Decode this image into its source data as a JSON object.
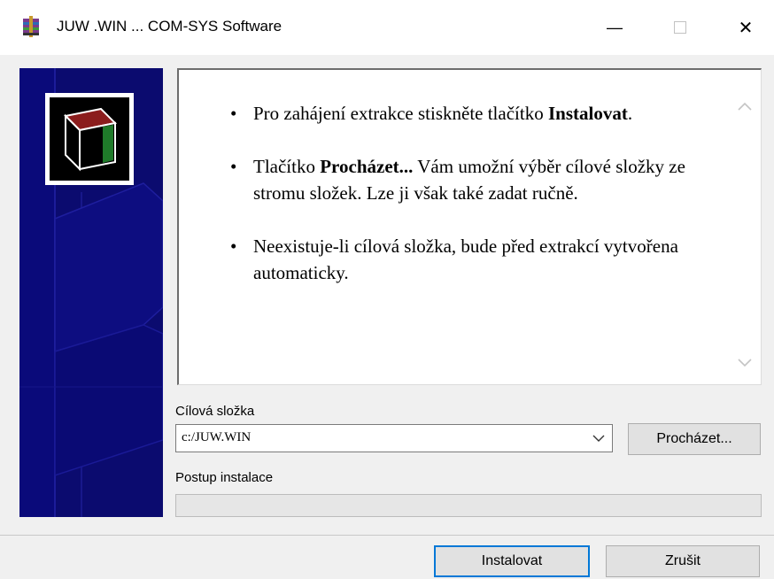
{
  "window": {
    "title": "JUW .WIN ... COM-SYS Software",
    "minimize_symbol": "—",
    "close_symbol": "✕"
  },
  "icons": {
    "app": "archive-icon",
    "logo": "box-icon",
    "scroll_up": "chevron-up-icon",
    "scroll_down": "chevron-down-icon",
    "dropdown": "chevron-down-icon"
  },
  "instructions": [
    {
      "before": "Pro zahájení extrakce stiskněte tlačítko ",
      "bold": "Instalovat",
      "after": "."
    },
    {
      "before": "Tlačítko ",
      "bold": "Procházet...",
      "after": " Vám umožní výběr cílové složky ze stromu složek. Lze ji však také zadat ručně."
    },
    {
      "before": "Neexistuje-li cílová složka, bude před extrakcí vytvořena automaticky.",
      "bold": "",
      "after": ""
    }
  ],
  "target": {
    "label": "Cílová složka",
    "value": "c:/JUW.WIN"
  },
  "browse_button": "Procházet...",
  "progress": {
    "label": "Postup instalace",
    "value": 0
  },
  "buttons": {
    "install": "Instalovat",
    "cancel": "Zrušit"
  },
  "colors": {
    "banner": "#0b0b6f",
    "default_button_border": "#0078d7"
  }
}
